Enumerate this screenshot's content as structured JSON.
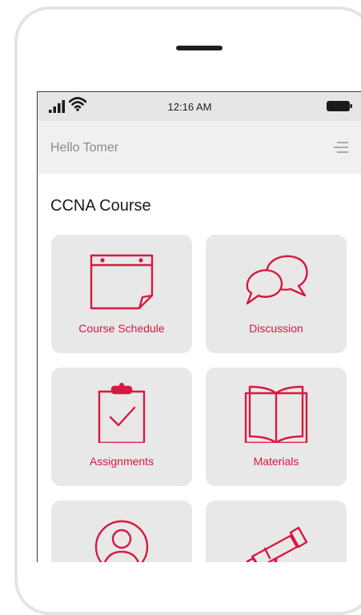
{
  "status_bar": {
    "time": "12:16 AM",
    "icons": [
      "signal-icon",
      "wifi-icon",
      "battery-icon"
    ]
  },
  "header": {
    "greeting": "Hello Tomer",
    "menu_icon": "hamburger-menu-icon"
  },
  "course": {
    "title": "CCNA Course"
  },
  "tiles": [
    {
      "label": "Course Schedule",
      "icon": "calendar-icon"
    },
    {
      "label": "Discussion",
      "icon": "chat-bubbles-icon"
    },
    {
      "label": "Assignments",
      "icon": "clipboard-check-icon"
    },
    {
      "label": "Materials",
      "icon": "open-book-icon"
    },
    {
      "label": "",
      "icon": "user-profile-icon"
    },
    {
      "label": "",
      "icon": "telescope-icon"
    }
  ],
  "colors": {
    "accent": "#d7193f",
    "tile_bg": "#e8e8e8",
    "header_bg": "#f0f0f0",
    "status_bg": "#e6e6e6"
  }
}
